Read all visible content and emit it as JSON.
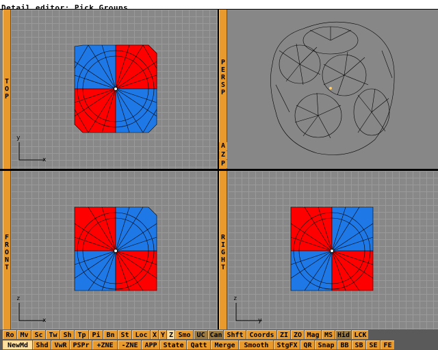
{
  "window": {
    "title": "Detail editor: Pick Groups"
  },
  "viewports": {
    "top": {
      "label": "TOP",
      "axis_v": "y",
      "axis_h": "x"
    },
    "persp": {
      "label": "PERSP",
      "btn_a": "A",
      "btn_z": "Z",
      "btn_p": "P"
    },
    "front": {
      "label": "FRONT",
      "axis_v": "z",
      "axis_h": "x"
    },
    "right": {
      "label": "RIGHT",
      "axis_v": "z",
      "axis_h": "y"
    }
  },
  "colors": {
    "red_group": "#ff0000",
    "blue_group": "#1e78e6",
    "accent": "#e89a2c"
  },
  "toolbar_row1": [
    "Ro",
    "Mv",
    "Sc",
    "Tw",
    "Sh",
    "Tp",
    "Pi",
    "Bn",
    "St",
    "Loc",
    "X",
    "Y",
    "Z",
    "Smo",
    "UC",
    "Can",
    "Shft",
    "Coords",
    "ZI",
    "ZO",
    "Mag",
    "MS",
    "Hid",
    "LCK"
  ],
  "toolbar_row2": [
    "NewMd",
    "Shd",
    "VwR",
    "PSPr",
    "+ZNE",
    "-ZNE",
    "APP",
    "State",
    "Qatt",
    "Merge",
    "Smooth",
    "StgFX",
    "QR",
    "Snap",
    "BB",
    "SB",
    "SE",
    "FE"
  ]
}
